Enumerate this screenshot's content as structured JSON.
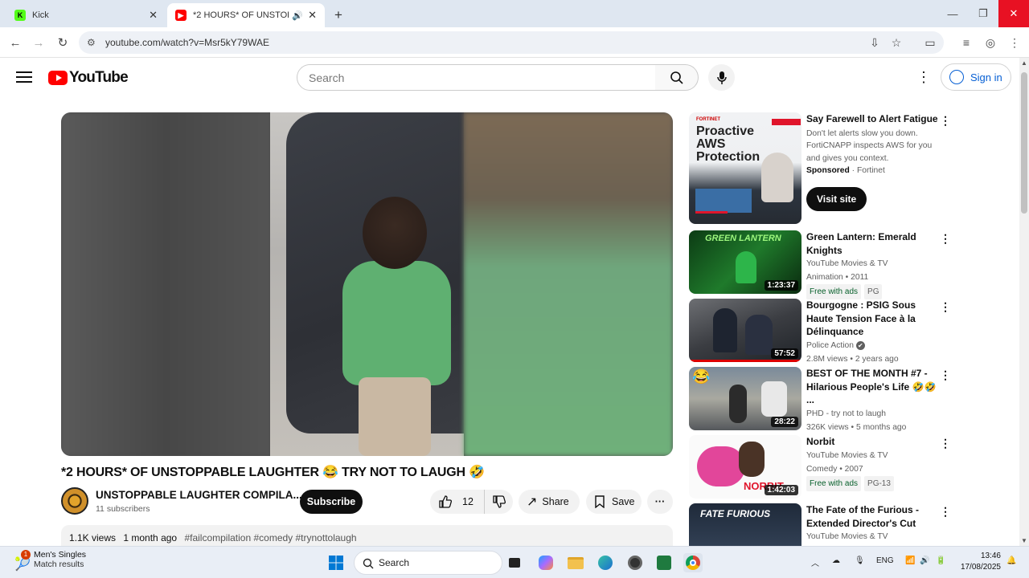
{
  "browser": {
    "tabs": [
      {
        "title": "Kick",
        "active": false,
        "favicon_color": "#53fc18"
      },
      {
        "title": "*2 HOURS* OF UNSTOPPAB",
        "active": true,
        "favicon_color": "#ff0000"
      }
    ],
    "new_tab": "+",
    "window_buttons": {
      "minimize": "—",
      "restore": "❐",
      "close": "✕"
    },
    "url": "youtube.com/watch?v=Msr5kY79WAE"
  },
  "youtube": {
    "logo_text": "YouTube",
    "search_placeholder": "Search",
    "sign_in": "Sign in"
  },
  "video": {
    "title": "*2 HOURS* OF UNSTOPPABLE LAUGHTER 😂 TRY NOT TO LAUGH 🤣",
    "channel_name": "UNSTOPPABLE LAUGHTER COMPILA...",
    "subscribers": "11 subscribers",
    "subscribe_label": "Subscribe",
    "likes": "12",
    "share_label": "Share",
    "save_label": "Save",
    "more_label": "···",
    "views": "1.1K views",
    "age": "1 month ago",
    "tags": "#failcompilation #comedy #trynottolaugh"
  },
  "recommendations": [
    {
      "title": "Say Farewell to Alert Fatigue",
      "line1": "Don't let alerts slow you down.",
      "line2": "FortiCNAPP inspects AWS for you",
      "line3": "and gives you context.",
      "sponsored": "Sponsored",
      "advertiser": "· Fortinet",
      "cta": "Visit site",
      "thumb_brand": "FORTINET",
      "thumb_text_1": "Proactive",
      "thumb_text_2": "AWS",
      "thumb_text_3": "Protection"
    },
    {
      "title": "Green Lantern: Emerald Knights",
      "channel": "YouTube Movies & TV",
      "meta": "Animation • 2011",
      "badge": "Free with ads",
      "rating": "PG",
      "duration": "1:23:37",
      "thumb_text": "GREEN LANTERN"
    },
    {
      "title": "Bourgogne : PSIG Sous Haute Tension Face à la Délinquance",
      "channel": "Police Action",
      "meta": "2.8M views • 2 years ago",
      "duration": "57:52",
      "verified": "✔"
    },
    {
      "title": "BEST OF THE MONTH #7 - Hilarious People's Life 🤣🤣 ...",
      "channel": "PHD - try not to laugh",
      "meta": "326K views • 5 months ago",
      "duration": "28:22"
    },
    {
      "title": "Norbit",
      "channel": "YouTube Movies & TV",
      "meta": "Comedy • 2007",
      "badge": "Free with ads",
      "rating": "PG-13",
      "duration": "1:42:03",
      "thumb_text": "NORBIT"
    },
    {
      "title": "The Fate of the Furious - Extended Director's Cut",
      "channel": "YouTube Movies & TV",
      "thumb_text": "FATE FURIOUS"
    }
  ],
  "taskbar": {
    "weather_title": "Men's Singles",
    "weather_sub": "Match results",
    "notification_count": "1",
    "search": "Search",
    "lang": "ENG",
    "time": "13:46",
    "date": "17/08/2025"
  }
}
